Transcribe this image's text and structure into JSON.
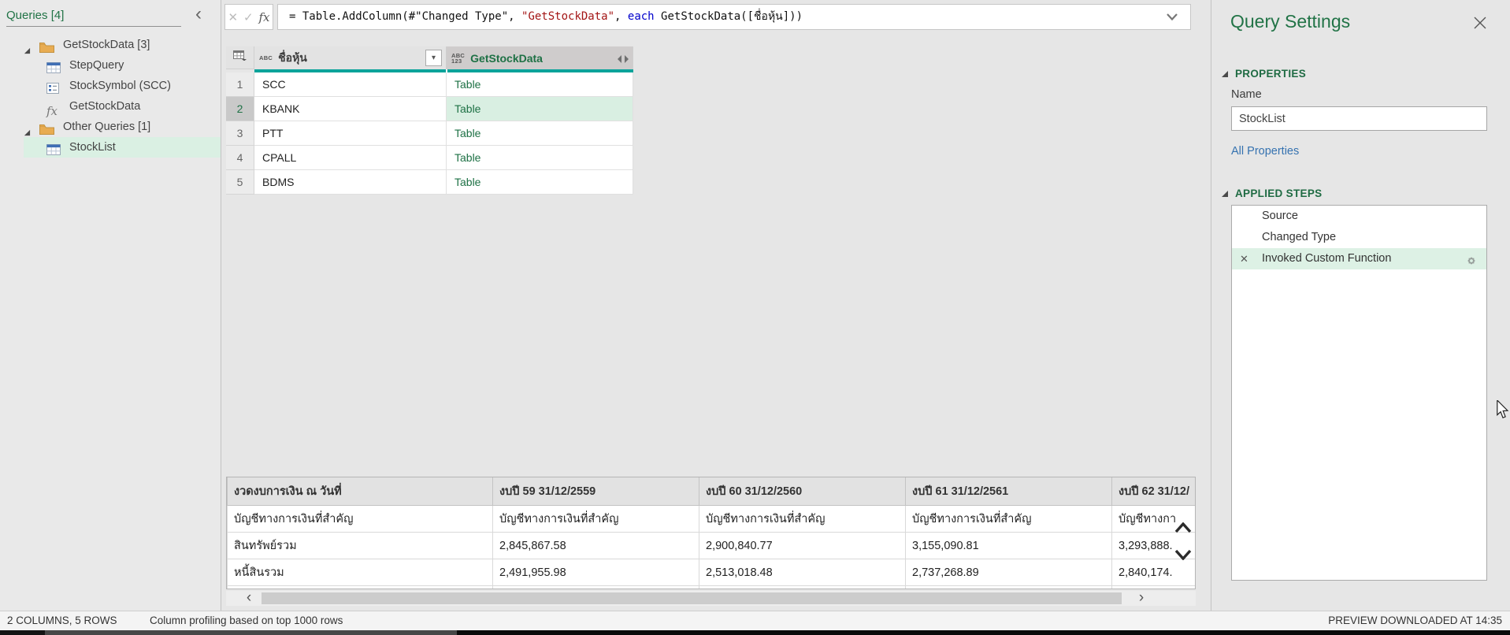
{
  "colors": {
    "accent_green": "#217346",
    "section_green": "#1f6b43",
    "selection_bg": "#daf0e3",
    "quality_bar_teal": "#0aa39a",
    "table_link_green": "#1e7145",
    "link_blue": "#3572b0",
    "formula_string_red": "#a31515",
    "formula_keyword_blue": "#0000cc"
  },
  "icons": {
    "collapse": "‹",
    "cancel": "✕",
    "confirm": "✓",
    "fx": "fx",
    "dropdown": "▾",
    "scroll_left": "‹",
    "scroll_right": "›",
    "delete_step": "✕"
  },
  "sidebar": {
    "title": "Queries [4]",
    "groups": [
      {
        "label": "GetStockData [3]",
        "expanded": true,
        "items": [
          {
            "label": "StepQuery",
            "icon": "table-icon",
            "selected": false
          },
          {
            "label": "StockSymbol (SCC)",
            "icon": "parameter-icon",
            "selected": false
          },
          {
            "label": "GetStockData",
            "icon": "function-icon",
            "selected": false
          }
        ]
      },
      {
        "label": "Other Queries [1]",
        "expanded": true,
        "items": [
          {
            "label": "StockList",
            "icon": "table-icon",
            "selected": true
          }
        ]
      }
    ]
  },
  "formula_bar": {
    "segments": [
      {
        "type": "plain",
        "text": "= Table.AddColumn(#\"Changed Type\", "
      },
      {
        "type": "string",
        "text": "\"GetStockData\""
      },
      {
        "type": "plain",
        "text": ", "
      },
      {
        "type": "keyword",
        "text": "each"
      },
      {
        "type": "plain",
        "text": " GetStockData([ชื่อหุ้น]))"
      }
    ]
  },
  "grid": {
    "columns": [
      {
        "label": "ชื่อหุ้น",
        "type_icon_lines": [
          "ABC"
        ],
        "control": "filter-dropdown",
        "selected": false
      },
      {
        "label": "GetStockData",
        "type_icon_lines": [
          "ABC",
          "123"
        ],
        "control": "expand-column",
        "selected": true
      }
    ],
    "rows": [
      {
        "num": "1",
        "cells": [
          "SCC",
          "Table"
        ],
        "selected": false
      },
      {
        "num": "2",
        "cells": [
          "KBANK",
          "Table"
        ],
        "selected": true
      },
      {
        "num": "3",
        "cells": [
          "PTT",
          "Table"
        ],
        "selected": false
      },
      {
        "num": "4",
        "cells": [
          "CPALL",
          "Table"
        ],
        "selected": false
      },
      {
        "num": "5",
        "cells": [
          "BDMS",
          "Table"
        ],
        "selected": false
      }
    ]
  },
  "preview_table": {
    "headers": [
      "งวดงบการเงิน ณ วันที่",
      "งบปี 59 31/12/2559",
      "งบปี 60 31/12/2560",
      "งบปี 61 31/12/2561",
      "งบปี 62 31/12/"
    ],
    "rows": [
      [
        "บัญชีทางการเงินที่สำคัญ",
        "บัญชีทางการเงินที่สำคัญ",
        "บัญชีทางการเงินที่สำคัญ",
        "บัญชีทางการเงินที่สำคัญ",
        "บัญชีทางกา"
      ],
      [
        "สินทรัพย์รวม",
        "2,845,867.58",
        "2,900,840.77",
        "3,155,090.81",
        "3,293,888."
      ],
      [
        "หนี้สินรวม",
        "2,491,955.98",
        "2,513,018.48",
        "2,737,268.89",
        "2,840,174."
      ],
      [
        "",
        "",
        "",
        "",
        ""
      ]
    ]
  },
  "query_settings": {
    "title": "Query Settings",
    "properties_label": "PROPERTIES",
    "name_label": "Name",
    "name_value": "StockList",
    "all_properties_label": "All Properties",
    "applied_steps_label": "APPLIED STEPS",
    "steps": [
      {
        "label": "Source",
        "selected": false,
        "deletable": false,
        "has_settings": false
      },
      {
        "label": "Changed Type",
        "selected": false,
        "deletable": false,
        "has_settings": false
      },
      {
        "label": "Invoked Custom Function",
        "selected": true,
        "deletable": true,
        "has_settings": true
      }
    ]
  },
  "status_bar": {
    "left": "2 COLUMNS, 5 ROWS",
    "center": "Column profiling based on top 1000 rows",
    "right": "PREVIEW DOWNLOADED AT 14:35"
  }
}
